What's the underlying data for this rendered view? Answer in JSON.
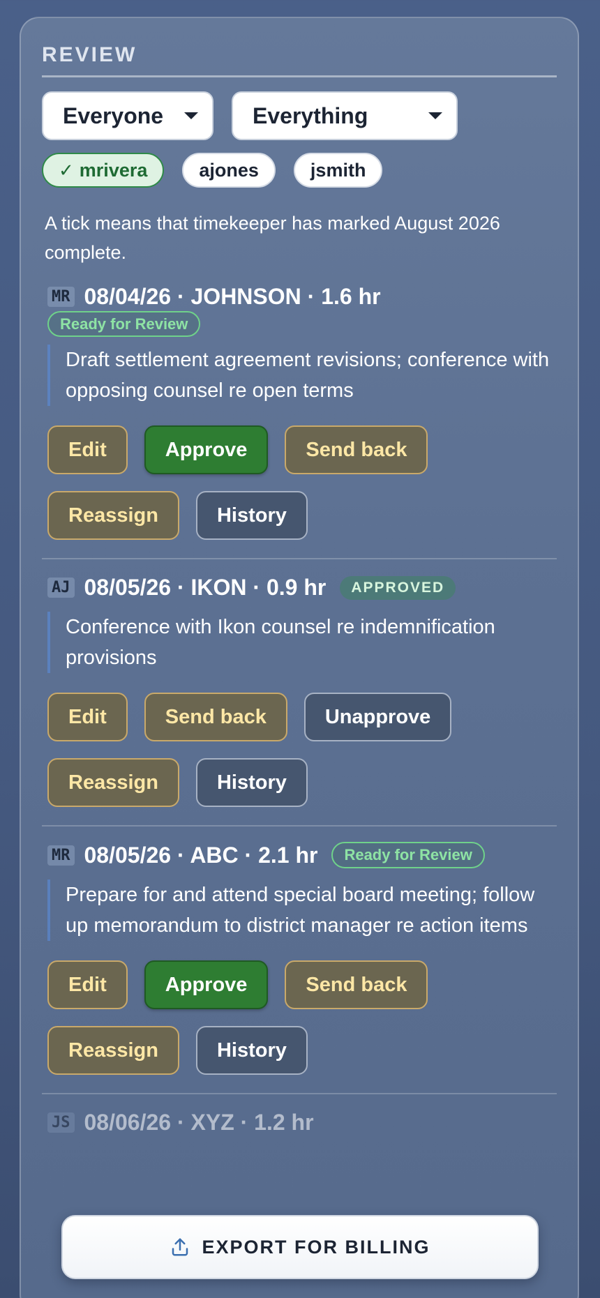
{
  "review": {
    "title": "REVIEW",
    "filters": {
      "person": "Everyone",
      "scope": "Everything"
    },
    "timekeepers": [
      {
        "label": "mrivera",
        "checked": true,
        "tick": "✓"
      },
      {
        "label": "ajones",
        "checked": false
      },
      {
        "label": "jsmith",
        "checked": false
      }
    ],
    "note": "A tick means that timekeeper has marked August 2026 complete."
  },
  "entries": [
    {
      "initials": "MR",
      "title": "08/04/26 · JOHNSON · 1.6 hr",
      "status": "Ready for Review",
      "description": "Draft settlement agreement revisions; conference with opposing counsel re open terms",
      "actions": {
        "edit": "Edit",
        "approve": "Approve",
        "send_back": "Send back",
        "reassign": "Reassign",
        "history": "History"
      }
    },
    {
      "initials": "AJ",
      "title": "08/05/26 · IKON · 0.9 hr",
      "status": "APPROVED",
      "description": "Conference with Ikon counsel re indemnification provisions",
      "actions": {
        "edit": "Edit",
        "send_back": "Send back",
        "unapprove": "Unapprove",
        "reassign": "Reassign",
        "history": "History"
      }
    },
    {
      "initials": "MR",
      "title": "08/05/26 · ABC · 2.1 hr",
      "status": "Ready for Review",
      "description": "Prepare for and attend special board meeting; follow up memorandum to district manager re action items",
      "actions": {
        "edit": "Edit",
        "approve": "Approve",
        "send_back": "Send back",
        "reassign": "Reassign",
        "history": "History"
      }
    },
    {
      "initials": "JS",
      "title": "08/06/26 · XYZ · 1.2 hr"
    }
  ],
  "export": {
    "label": "EXPORT FOR BILLING",
    "icon": "upload-icon"
  }
}
